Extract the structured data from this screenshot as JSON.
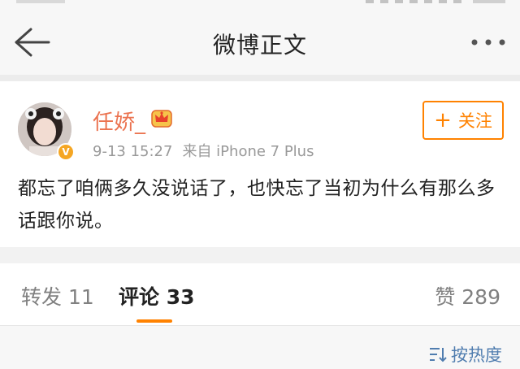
{
  "nav": {
    "title": "微博正文",
    "back_icon": "back-arrow-icon",
    "more_icon": "more-dots-icon"
  },
  "post": {
    "username": "任娇_",
    "verified_mark": "V",
    "timestamp": "9-13 15:27",
    "source": "来自 iPhone 7 Plus",
    "follow_plus": "+",
    "follow_label": "关注",
    "text": "都忘了咱俩多久没说话了，也快忘了当初为什么有那么多话跟你说。"
  },
  "tabs": {
    "repost_label": "转发",
    "repost_count": "11",
    "comment_label": "评论",
    "comment_count": "33",
    "like_label": "赞",
    "like_count": "289"
  },
  "sort": {
    "label": "按热度",
    "icon": "sort-icon"
  },
  "colors": {
    "accent_orange": "#ff8200",
    "username": "#eb7350",
    "link_blue": "#507daf"
  }
}
